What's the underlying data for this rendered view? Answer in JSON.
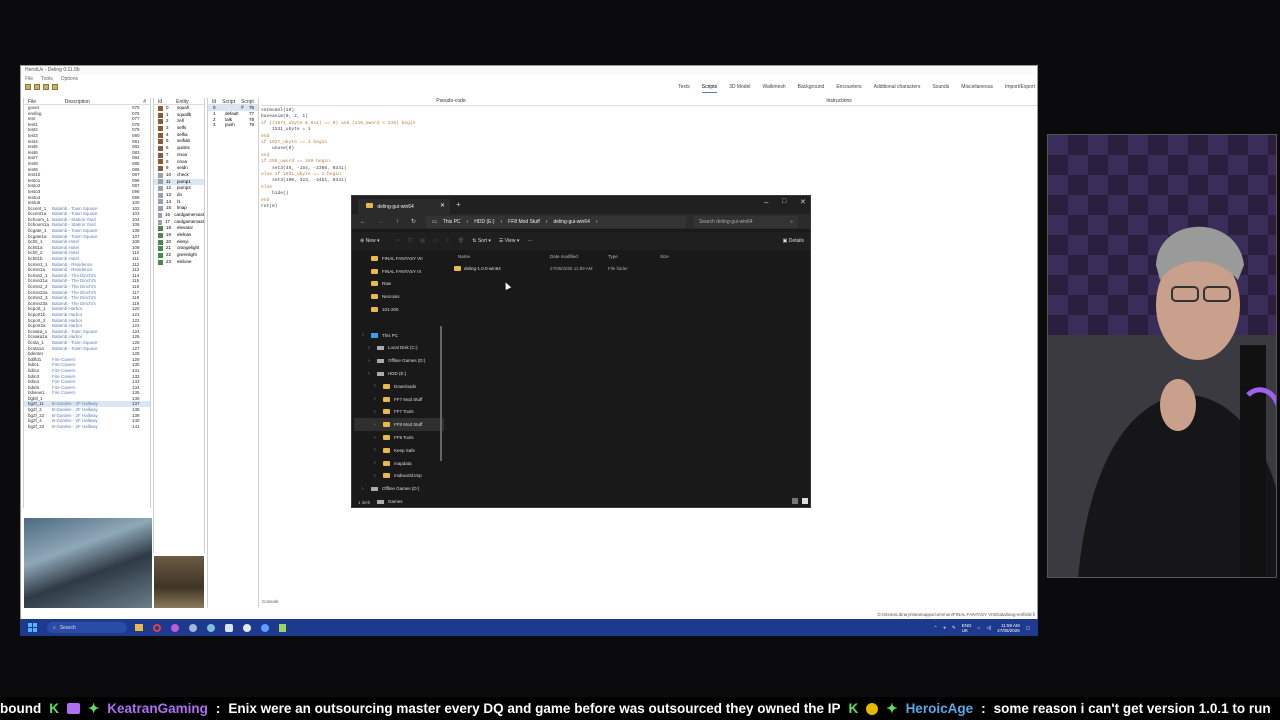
{
  "app": {
    "title": "HerotUv - Deling 0.11.0b",
    "menu": [
      "File",
      "Tools",
      "Options"
    ],
    "tabs": [
      "Texts",
      "Scripts",
      "3D Model",
      "Walkmesh",
      "Background",
      "Encounters",
      "Additional characters",
      "Sounds",
      "Miscellaneous",
      "Import/Export"
    ],
    "files": {
      "headers": [
        "File",
        "Description",
        "#"
      ],
      "rows": [
        [
          "gover",
          "",
          "075"
        ],
        [
          "ending",
          "",
          "076"
        ],
        [
          "test",
          "",
          "077"
        ],
        [
          "test1",
          "",
          "078"
        ],
        [
          "test2",
          "",
          "079"
        ],
        [
          "test3",
          "",
          "080"
        ],
        [
          "test4",
          "",
          "081"
        ],
        [
          "test5",
          "",
          "082"
        ],
        [
          "test6",
          "",
          "083"
        ],
        [
          "test7",
          "",
          "084"
        ],
        [
          "test8",
          "",
          "085"
        ],
        [
          "test9",
          "",
          "086"
        ],
        [
          "test10",
          "",
          "087"
        ],
        [
          "testo1",
          "",
          "096"
        ],
        [
          "testo2",
          "",
          "097"
        ],
        [
          "testo3",
          "",
          "098"
        ],
        [
          "testo4",
          "",
          "099"
        ],
        [
          "testo5",
          "",
          "100"
        ],
        [
          "bccent_1",
          "Balamb - Town Square",
          "102"
        ],
        [
          "bccent1a",
          "Balamb - Town Square",
          "103"
        ],
        [
          "bchoom_1",
          "Balamb - Station Yard",
          "104"
        ],
        [
          "bchoom1a",
          "Balamb - Station Yard",
          "105"
        ],
        [
          "bcgate_1",
          "Balamb - Town Square",
          "106"
        ],
        [
          "bcgate1a",
          "Balamb - Town Square",
          "107"
        ],
        [
          "bchtl_1",
          "Balamb Hotel",
          "108"
        ],
        [
          "bchtl1a",
          "Balamb Hotel",
          "109"
        ],
        [
          "bchtl_2",
          "Balamb Hotel",
          "110"
        ],
        [
          "bchtl1b",
          "Balamb Hotel",
          "111"
        ],
        [
          "bcmin1_1",
          "Balamb - Residence",
          "112"
        ],
        [
          "bcmin1a",
          "Balamb - Residence",
          "113"
        ],
        [
          "bcmin2_1",
          "Balamb - The Dincht's",
          "114"
        ],
        [
          "bcmin21a",
          "Balamb - The Dincht's",
          "115"
        ],
        [
          "bcmin2_2",
          "Balamb - The Dincht's",
          "116"
        ],
        [
          "bcmin22a",
          "Balamb - The Dincht's",
          "117"
        ],
        [
          "bcmin2_3",
          "Balamb - The Dincht's",
          "118"
        ],
        [
          "bcmin23a",
          "Balamb - The Dincht's",
          "119"
        ],
        [
          "bcport_1",
          "Balamb Harbor",
          "120"
        ],
        [
          "bcport1b",
          "Balamb Harbor",
          "121"
        ],
        [
          "bcport_2",
          "Balamb Harbor",
          "122"
        ],
        [
          "bcport2a",
          "Balamb Harbor",
          "123"
        ],
        [
          "bcsaka_1",
          "Balamb - Town Square",
          "124"
        ],
        [
          "bcsaka1a",
          "Balamb Harbor",
          "125"
        ],
        [
          "bcsta_1",
          "Balamb - Town Square",
          "126"
        ],
        [
          "bcsta1a",
          "Balamb - Town Square",
          "127"
        ],
        [
          "bdenter",
          "",
          "128"
        ],
        [
          "bdifld1",
          "Fire Cavern",
          "129"
        ],
        [
          "bdin1",
          "Fire Cavern",
          "130"
        ],
        [
          "bdin2",
          "Fire Cavern",
          "131"
        ],
        [
          "bdin3",
          "Fire Cavern",
          "132"
        ],
        [
          "bdin4",
          "Fire Cavern",
          "133"
        ],
        [
          "bdin5",
          "Fire Cavern",
          "134"
        ],
        [
          "bdview1",
          "Fire Cavern",
          "135"
        ],
        [
          "bgbtl_1",
          "",
          "136"
        ],
        [
          "bg2f_11",
          "B-Garden - 2F Hallway",
          "137"
        ],
        [
          "bg2f_2",
          "B-Garden - 2F Hallway",
          "138"
        ],
        [
          "bg2f_22",
          "B-Garden - 2F Hallway",
          "139"
        ],
        [
          "bg2f_4",
          "B-Garden - 2F Hallway",
          "140"
        ],
        [
          "bg2f_22",
          "B-Garden - 2F Hallway",
          "141"
        ]
      ]
    },
    "entities": {
      "headers": [
        "Id",
        "Entity"
      ],
      "rows": [
        [
          "0",
          "squall"
        ],
        [
          "1",
          "squallb"
        ],
        [
          "2",
          "zell"
        ],
        [
          "3",
          "selfs"
        ],
        [
          "4",
          "selfia"
        ],
        [
          "5",
          "seifiab"
        ],
        [
          "6",
          "quistis"
        ],
        [
          "7",
          "rinoa"
        ],
        [
          "8",
          "rinoa"
        ],
        [
          "9",
          "seidn"
        ],
        [
          "10",
          "check"
        ],
        [
          "11",
          "pump1"
        ],
        [
          "12",
          "pump2"
        ],
        [
          "13",
          "do"
        ],
        [
          "14",
          "l1"
        ],
        [
          "15",
          "lmap"
        ],
        [
          "16",
          "cardgamemast"
        ],
        [
          "17",
          "cardgamemast"
        ],
        [
          "18",
          "elevator"
        ],
        [
          "19",
          "elelnas"
        ],
        [
          "20",
          "elesyi"
        ],
        [
          "21",
          "orangelight"
        ],
        [
          "22",
          "greenlight"
        ],
        [
          "23",
          "elelone"
        ]
      ]
    },
    "scripts": {
      "headers": [
        "Id",
        "Script",
        "Script #"
      ],
      "rows": [
        [
          "0",
          "",
          "76"
        ],
        [
          "1",
          "default",
          "77"
        ],
        [
          "2",
          "talk",
          "78"
        ],
        [
          "3",
          "push",
          "79"
        ]
      ]
    },
    "pseudo_label": "Pseudo-code",
    "instructions_label": "Instructions",
    "code_lines": [
      "setmodel(10)",
      "baseanim(0, 2, 1)",
      "if ((1674_ubyte & 0x1) == 0) and (216_uword < 216) begin",
      "    1531_ubyte = 1",
      "end",
      "if 1027_ubyte == 1 begin",
      "    unuse(0)",
      "end",
      "if 256_uword == 340 begin",
      "    set3(45, -154, -2308, 0341)",
      "else if 1031_ubyte == 1 begin",
      "    set3(100, 323, -3451, 0341)",
      "else",
      "    hide()",
      "end",
      "ret(8)"
    ],
    "console_label": "Console",
    "path": "D:/SteamLibrary/steamapps/common/FINAL FANTASY VIII/Data/lang-en/field.fi"
  },
  "explorer": {
    "tab_title": "deling-gui-win64",
    "breadcrumb": [
      "This PC",
      "HDD (E:)",
      "FF8 Mod Stuff",
      "deling-gui-win64"
    ],
    "search_placeholder": "Search deling-gui-win64",
    "commands": {
      "new": "New",
      "sort": "Sort",
      "view": "View",
      "details": "Details"
    },
    "sidebar": [
      {
        "label": "FINAL FANTASY VII",
        "indent": 0
      },
      {
        "label": "FINAL FANTASY IX",
        "indent": 0
      },
      {
        "label": "Raw",
        "indent": 0
      },
      {
        "label": "Necrosis",
        "indent": 0
      },
      {
        "label": "101-200",
        "indent": 0
      },
      {
        "label": "",
        "indent": 0
      },
      {
        "label": "This PC",
        "indent": 0
      },
      {
        "label": "Local Disk (C:)",
        "indent": 1
      },
      {
        "label": "Offline Games (D:)",
        "indent": 1
      },
      {
        "label": "HDD (E:)",
        "indent": 1
      },
      {
        "label": "Downloads",
        "indent": 2
      },
      {
        "label": "FF7 Mod Stuff",
        "indent": 2
      },
      {
        "label": "FF7 Tools",
        "indent": 2
      },
      {
        "label": "FF8 Mod Stuff",
        "indent": 2
      },
      {
        "label": "FF9 Tools",
        "indent": 2
      },
      {
        "label": "Keep Safe",
        "indent": 2
      },
      {
        "label": "mapdata",
        "indent": 2
      },
      {
        "label": "midiworld.tmp",
        "indent": 2
      },
      {
        "label": "Offline Games (D:)",
        "indent": 0
      },
      {
        "label": "Games",
        "indent": 1
      }
    ],
    "columns": [
      "Name",
      "Date modified",
      "Type",
      "Size"
    ],
    "files": [
      {
        "name": "deling-1.0.0-win64",
        "date": "27/05/2026 11:59 AM",
        "type": "File folder",
        "size": ""
      }
    ],
    "status": "1 item"
  },
  "taskbar": {
    "search_placeholder": "Search",
    "lang": "ENG",
    "region": "UK",
    "time": "11:59 AM",
    "date": "27/05/2026"
  },
  "ticker": {
    "lead": "bound",
    "user1": "KeatranGaming",
    "msg1": "Enix were an outsourcing master every DQ and game before was outsourced they owned the IP",
    "user2": "HeroicAge",
    "msg2": "some reason i can't get version 1.0.1 to run"
  },
  "colors": {
    "accent": "#1d3a8e",
    "folder": "#e8b84a",
    "chat_user1": "#b06ef3",
    "chat_user2": "#5aa8e6"
  }
}
